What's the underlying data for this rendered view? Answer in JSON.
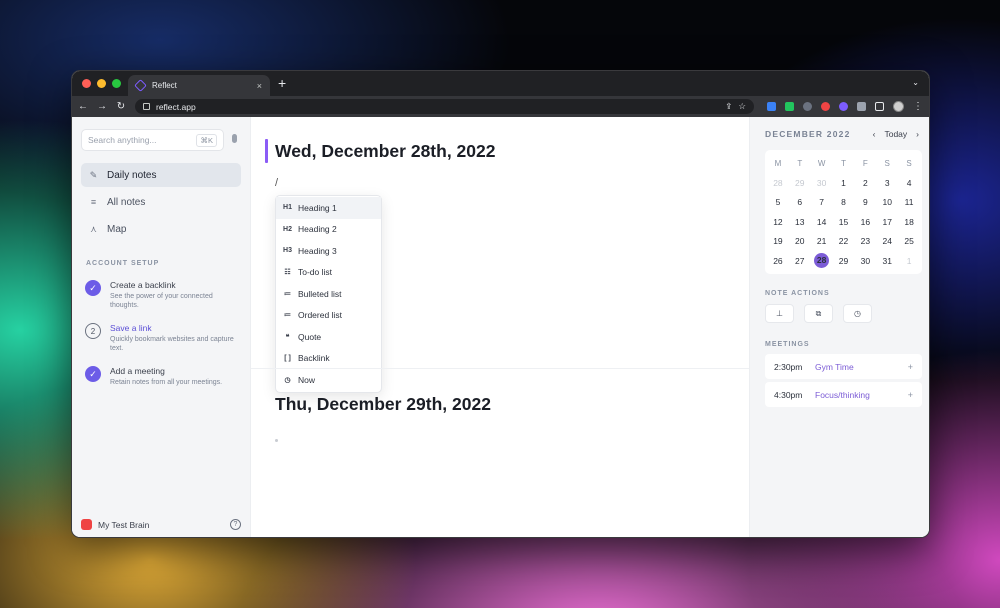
{
  "browser": {
    "tab_title": "Reflect",
    "tab_close": "×",
    "new_tab": "+",
    "tab_menu": "⌄",
    "back": "←",
    "forward": "→",
    "reload": "↻",
    "url": "reflect.app",
    "share": "⇪",
    "bookmark": "☆",
    "menu": "⋮",
    "colors": {
      "tab_bar": "#202124",
      "toolbar": "#35363a"
    }
  },
  "sidebar": {
    "search_placeholder": "Search anything...",
    "search_shortcut": "⌘K",
    "nav": [
      {
        "label": "Daily notes",
        "icon": "✎"
      },
      {
        "label": "All notes",
        "icon": "≡"
      },
      {
        "label": "Map",
        "icon": "⋏"
      }
    ],
    "setup_label": "ACCOUNT SETUP",
    "setup": [
      {
        "marker": "✓",
        "title": "Create a backlink",
        "desc": "See the power of your connected thoughts."
      },
      {
        "marker": "2",
        "title": "Save a link",
        "desc": "Quickly bookmark websites and capture text."
      },
      {
        "marker": "✓",
        "title": "Add a meeting",
        "desc": "Retain notes from all your meetings."
      }
    ],
    "brain_name": "My Test Brain",
    "help": "?"
  },
  "editor": {
    "note1_title": "Wed, December 28th, 2022",
    "slash_text": "/",
    "menu": [
      {
        "icon": "H1",
        "label": "Heading 1"
      },
      {
        "icon": "H2",
        "label": "Heading 2"
      },
      {
        "icon": "H3",
        "label": "Heading 3"
      },
      {
        "icon": "☷",
        "label": "To-do list"
      },
      {
        "icon": "≔",
        "label": "Bulleted list"
      },
      {
        "icon": "≔",
        "label": "Ordered list"
      },
      {
        "icon": "❝",
        "label": "Quote"
      },
      {
        "icon": "[ ]",
        "label": "Backlink"
      },
      {
        "icon": "◷",
        "label": "Now"
      }
    ],
    "note2_title": "Thu, December 29th, 2022"
  },
  "calendar": {
    "month": "DECEMBER 2022",
    "prev": "‹",
    "today_button": "Today",
    "next": "›",
    "weekdays": [
      "M",
      "T",
      "W",
      "T",
      "F",
      "S",
      "S"
    ],
    "weeks": [
      [
        "28",
        "29",
        "30",
        "1",
        "2",
        "3",
        "4"
      ],
      [
        "5",
        "6",
        "7",
        "8",
        "9",
        "10",
        "11"
      ],
      [
        "12",
        "13",
        "14",
        "15",
        "16",
        "17",
        "18"
      ],
      [
        "19",
        "20",
        "21",
        "22",
        "23",
        "24",
        "25"
      ],
      [
        "26",
        "27",
        "28",
        "29",
        "30",
        "31",
        "1"
      ]
    ],
    "selected": "28",
    "accent": "#7c5cd6"
  },
  "note_actions": {
    "label": "NOTE ACTIONS",
    "items": [
      {
        "icon": "⊥"
      },
      {
        "icon": "⧉"
      },
      {
        "icon": "◷"
      }
    ]
  },
  "meetings": {
    "label": "MEETINGS",
    "items": [
      {
        "time": "2:30pm",
        "name": "Gym Time",
        "plus": "+"
      },
      {
        "time": "4:30pm",
        "name": "Focus/thinking",
        "plus": "+"
      }
    ]
  }
}
